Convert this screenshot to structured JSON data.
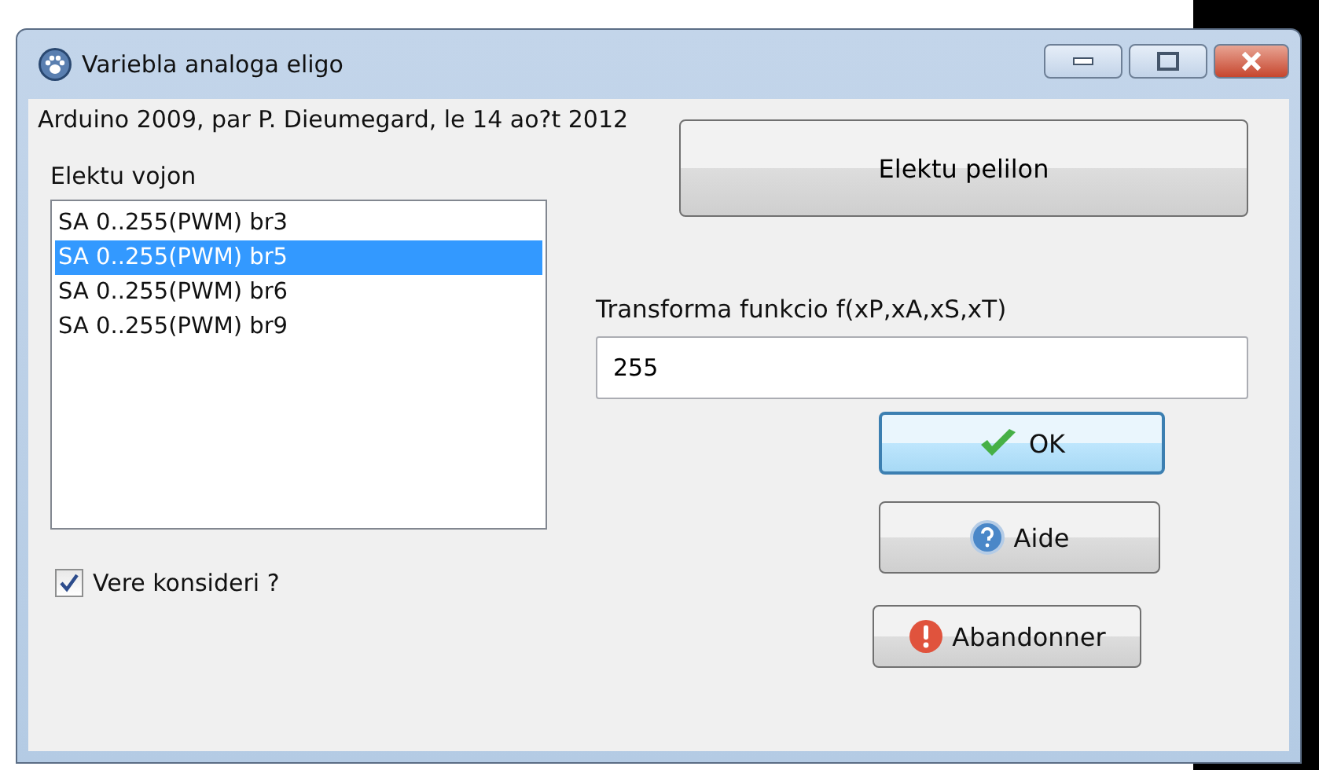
{
  "window": {
    "title": "Variebla analoga eligo"
  },
  "credit": "Arduino 2009, par P. Dieumegard, le 14 ao?t 2012",
  "list": {
    "label": "Elektu vojon",
    "items": [
      {
        "text": "SA 0..255(PWM) br3",
        "selected": false
      },
      {
        "text": "SA 0..255(PWM) br5",
        "selected": true
      },
      {
        "text": "SA 0..255(PWM) br6",
        "selected": false
      },
      {
        "text": "SA 0..255(PWM) br9",
        "selected": false
      }
    ]
  },
  "checkbox": {
    "label": "Vere konsideri ?",
    "checked": true
  },
  "pick_button": "Elektu pelilon",
  "function": {
    "label": "Transforma funkcio f(xP,xA,xS,xT)",
    "value": "255"
  },
  "buttons": [
    {
      "kind": "ok",
      "label": "OK",
      "default": true
    },
    {
      "kind": "help",
      "label": "Aide",
      "default": false
    },
    {
      "kind": "cancel",
      "label": "Abandonner",
      "default": false
    }
  ]
}
